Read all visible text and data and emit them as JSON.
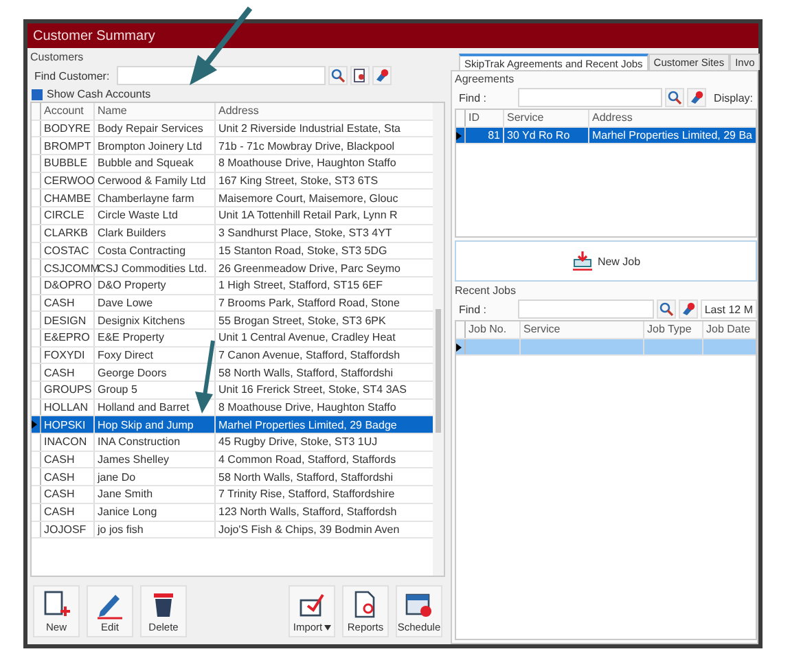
{
  "window": {
    "title": "Customer Summary"
  },
  "customers": {
    "group_label": "Customers",
    "find_label": "Find Customer:",
    "show_cash": {
      "label": "Show Cash Accounts",
      "checked": true
    },
    "columns": [
      "Account",
      "Name",
      "Address"
    ],
    "rows": [
      {
        "cells": [
          "BODYRE",
          "Body Repair Services",
          "Unit 2 Riverside Industrial Estate, Sta"
        ],
        "selected": false
      },
      {
        "cells": [
          "BROMPT",
          "Brompton Joinery Ltd",
          "71b - 71c Mowbray Drive, Blackpool"
        ],
        "selected": false
      },
      {
        "cells": [
          "BUBBLE",
          "Bubble and Squeak",
          "8 Moathouse Drive, Haughton Staffo"
        ],
        "selected": false
      },
      {
        "cells": [
          "CERWOO",
          "Cerwood & Family Ltd",
          "167 King Street, Stoke, ST3 6TS"
        ],
        "selected": false
      },
      {
        "cells": [
          "CHAMBE",
          "Chamberlayne farm",
          "Maisemore Court, Maisemore, Glouc"
        ],
        "selected": false
      },
      {
        "cells": [
          "CIRCLE",
          "Circle Waste Ltd",
          "Unit 1A Tottenhill Retail Park, Lynn R"
        ],
        "selected": false
      },
      {
        "cells": [
          "CLARKB",
          "Clark Builders",
          "3 Sandhurst Place, Stoke, ST3 4YT"
        ],
        "selected": false
      },
      {
        "cells": [
          "COSTAC",
          "Costa Contracting",
          "15 Stanton Road, Stoke, ST3 5DG"
        ],
        "selected": false
      },
      {
        "cells": [
          "CSJCOMM",
          "CSJ Commodities Ltd.",
          "26 Greenmeadow Drive, Parc Seymo"
        ],
        "selected": false
      },
      {
        "cells": [
          "D&OPRO",
          "D&O Property",
          "1 High Street, Stafford, ST15 6EF"
        ],
        "selected": false
      },
      {
        "cells": [
          "CASH",
          "Dave Lowe",
          "7 Brooms Park, Stafford Road, Stone"
        ],
        "selected": false
      },
      {
        "cells": [
          "DESIGN",
          "Designix Kitchens",
          "55 Brogan Street, Stoke, ST3 6PK"
        ],
        "selected": false
      },
      {
        "cells": [
          "E&EPRO",
          "E&E Property",
          "Unit 1 Central Avenue, Cradley Heat"
        ],
        "selected": false
      },
      {
        "cells": [
          "FOXYDI",
          "Foxy Direct",
          "7 Canon Avenue, Stafford, Staffordsh"
        ],
        "selected": false
      },
      {
        "cells": [
          "CASH",
          "George Doors",
          "58 North Walls, Stafford, Staffordshi"
        ],
        "selected": false
      },
      {
        "cells": [
          "GROUPS",
          "Group 5",
          "Unit 16 Frerick Street, Stoke, ST4 3AS"
        ],
        "selected": false
      },
      {
        "cells": [
          "HOLLAN",
          "Holland and Barret",
          "8 Moathouse Drive, Haughton Staffo"
        ],
        "selected": false
      },
      {
        "cells": [
          "HOPSKI",
          "Hop Skip and Jump",
          "Marhel Properties Limited, 29 Badge"
        ],
        "selected": true
      },
      {
        "cells": [
          "INACON",
          "INA Construction",
          "45 Rugby Drive, Stoke, ST3 1UJ"
        ],
        "selected": false
      },
      {
        "cells": [
          "CASH",
          "James Shelley",
          "4 Common Road, Stafford, Staffords"
        ],
        "selected": false
      },
      {
        "cells": [
          "CASH",
          "jane Do",
          "58 North Walls, Stafford, Staffordshi"
        ],
        "selected": false
      },
      {
        "cells": [
          "CASH",
          "Jane Smith",
          "7 Trinity Rise, Stafford, Staffordshire"
        ],
        "selected": false
      },
      {
        "cells": [
          "CASH",
          "Janice Long",
          "123 North Walls, Stafford, Staffordsh"
        ],
        "selected": false
      },
      {
        "cells": [
          "JOJOSF",
          "jo jos fish",
          "Jojo'S Fish & Chips, 39 Bodmin Aven"
        ],
        "selected": false
      }
    ]
  },
  "toolbar": [
    {
      "label": "New",
      "kind": "new",
      "dropdown": false
    },
    {
      "label": "Edit",
      "kind": "edit",
      "dropdown": false
    },
    {
      "label": "Delete",
      "kind": "delete",
      "dropdown": false
    },
    {
      "label": "Import",
      "kind": "import",
      "dropdown": true
    },
    {
      "label": "Reports",
      "kind": "reports",
      "dropdown": false
    },
    {
      "label": "Schedule",
      "kind": "schedule",
      "dropdown": false
    }
  ],
  "tabs": [
    {
      "label": "SkipTrak Agreements and Recent Jobs",
      "selected": true
    },
    {
      "label": "Customer Sites",
      "selected": false
    },
    {
      "label": "Invo",
      "selected": false
    }
  ],
  "agreements": {
    "group_label": "Agreements",
    "find_label": "Find :",
    "display_label": "Display:",
    "columns": [
      "ID",
      "Service",
      "Address"
    ],
    "rows": [
      {
        "cells": [
          "81",
          "30 Yd Ro Ro",
          "Marhel Properties Limited, 29 Ba"
        ],
        "selected": true
      }
    ],
    "new_job": "New Job"
  },
  "recent_jobs": {
    "group_label": "Recent Jobs",
    "find_label": "Find :",
    "period": "Last 12 M",
    "columns": [
      "Job No.",
      "Service",
      "Job Type",
      "Job Date"
    ],
    "rows": [
      {
        "selected": true
      }
    ]
  }
}
